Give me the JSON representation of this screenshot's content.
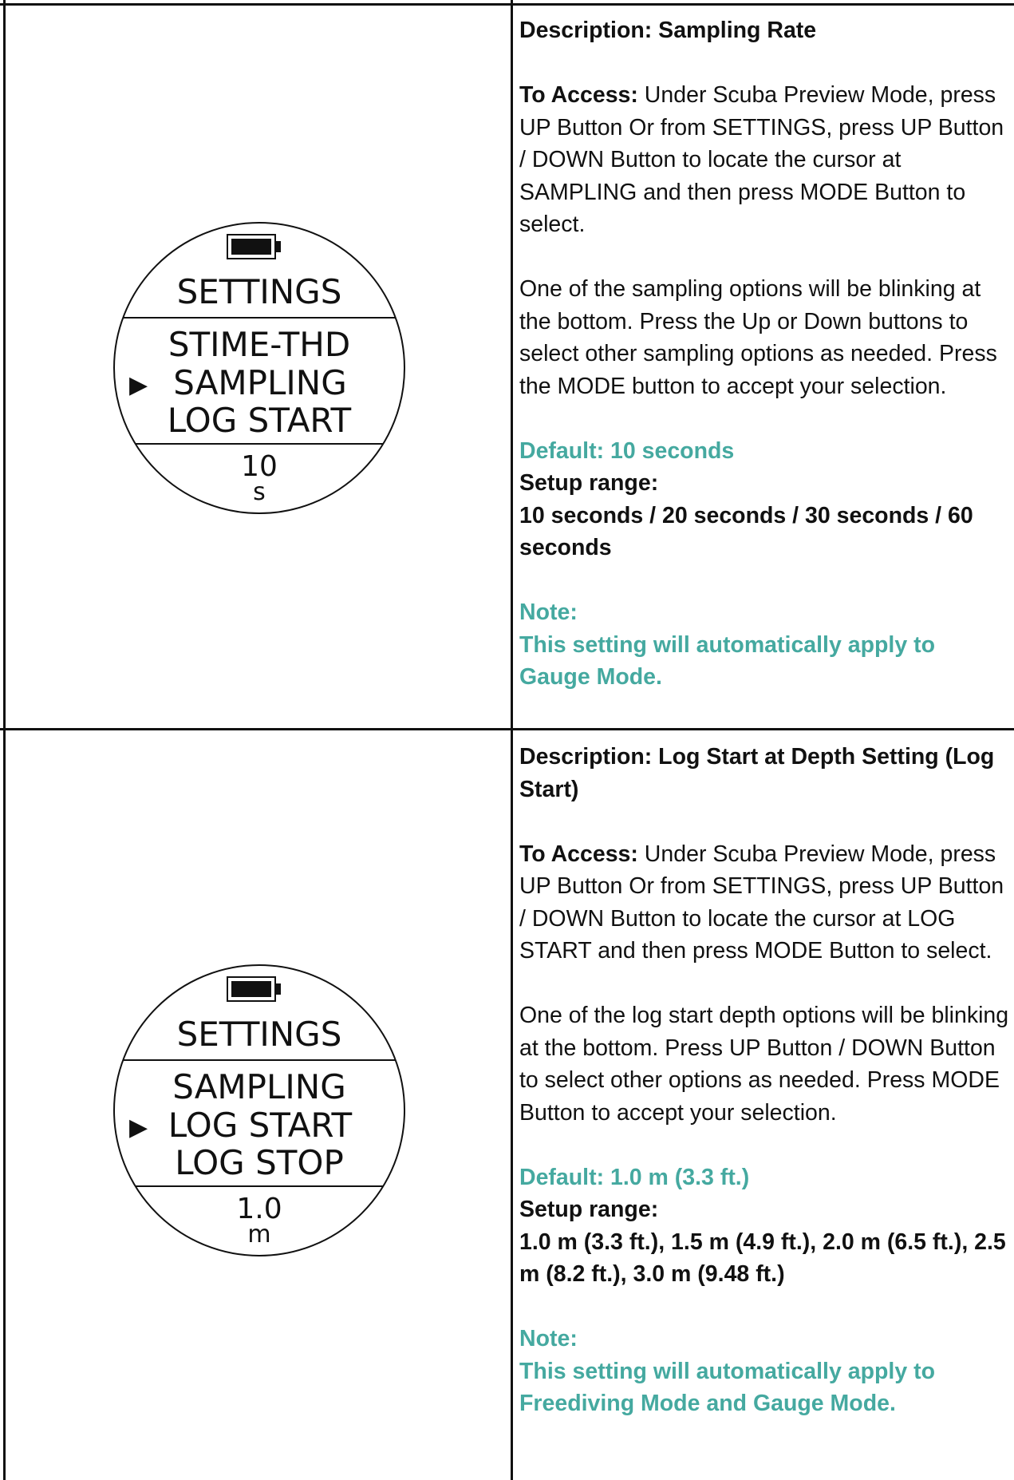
{
  "rows": [
    {
      "watch": {
        "header": "SETTINGS",
        "menu": [
          "STIME-THD",
          "SAMPLING",
          "LOG START"
        ],
        "cursor": "▶",
        "selected_index": 1,
        "value": "10",
        "unit": "s"
      },
      "description": "Description: Sampling Rate",
      "access_label": "To Access:",
      "access_text": " Under Scuba Preview Mode, press UP Button Or from SETTINGS, press UP Button / DOWN Button to locate the cursor at SAMPLING and then press MODE Button to select.",
      "instructions": "One of the sampling options will be blinking at the bottom. Press the Up or Down buttons to select other sampling options as needed. Press the MODE button to accept your selection.",
      "default": "Default: 10 seconds",
      "setup_label": "Setup range:",
      "setup_range": "10 seconds / 20 seconds / 30 seconds / 60 seconds",
      "note_label": "Note:",
      "note_text": "This setting will automatically apply to Gauge Mode."
    },
    {
      "watch": {
        "header": "SETTINGS",
        "menu": [
          "SAMPLING",
          "LOG START",
          "LOG STOP"
        ],
        "cursor": "▶",
        "selected_index": 1,
        "value": "1.0",
        "unit": "m"
      },
      "description": "Description: Log Start at Depth Setting (Log Start)",
      "access_label": "To Access:",
      "access_text": " Under Scuba Preview Mode, press UP Button Or from SETTINGS, press UP Button / DOWN Button to locate the cursor at LOG START and then press MODE Button to select.",
      "instructions": "One of the log start depth options will be blinking at the bottom. Press UP Button / DOWN Button to select other options as needed. Press MODE Button to accept your selection.",
      "default": "Default: 1.0 m (3.3 ft.)",
      "setup_label": "Setup range:",
      "setup_range": "1.0 m (3.3 ft.), 1.5 m (4.9 ft.), 2.0 m (6.5 ft.), 2.5 m (8.2 ft.), 3.0 m (9.48 ft.)",
      "note_label": "Note:",
      "note_text": "This setting will automatically apply to Freediving Mode and Gauge Mode."
    }
  ]
}
